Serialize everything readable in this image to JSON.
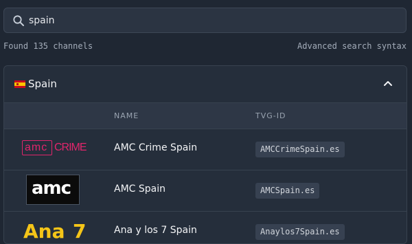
{
  "search": {
    "value": "spain"
  },
  "meta": {
    "found": "Found 135 channels",
    "advanced": "Advanced search syntax"
  },
  "group": {
    "country": "Spain"
  },
  "table": {
    "headers": {
      "name": "NAME",
      "tvgid": "TVG-ID"
    },
    "rows": [
      {
        "name": "AMC Crime Spain",
        "tvg_id": "AMCCrimeSpain.es",
        "logo": {
          "main": "amc",
          "sub": "CRIME",
          "color": "#e2256b"
        }
      },
      {
        "name": "AMC Spain",
        "tvg_id": "AMCSpain.es",
        "logo": {
          "main": "amc"
        }
      },
      {
        "name": "Ana y los 7 Spain",
        "tvg_id": "Anaylos7Spain.es",
        "logo": {
          "main": "Ana",
          "sub": "7",
          "color": "#f5c518"
        }
      }
    ]
  },
  "colors": {
    "background": "#1f2733",
    "panel": "#252e3b",
    "accent_red": "#e2256b"
  },
  "icons": {
    "search": "search-icon",
    "collapse": "chevron-up-icon",
    "flag": "flag-spain-icon"
  }
}
